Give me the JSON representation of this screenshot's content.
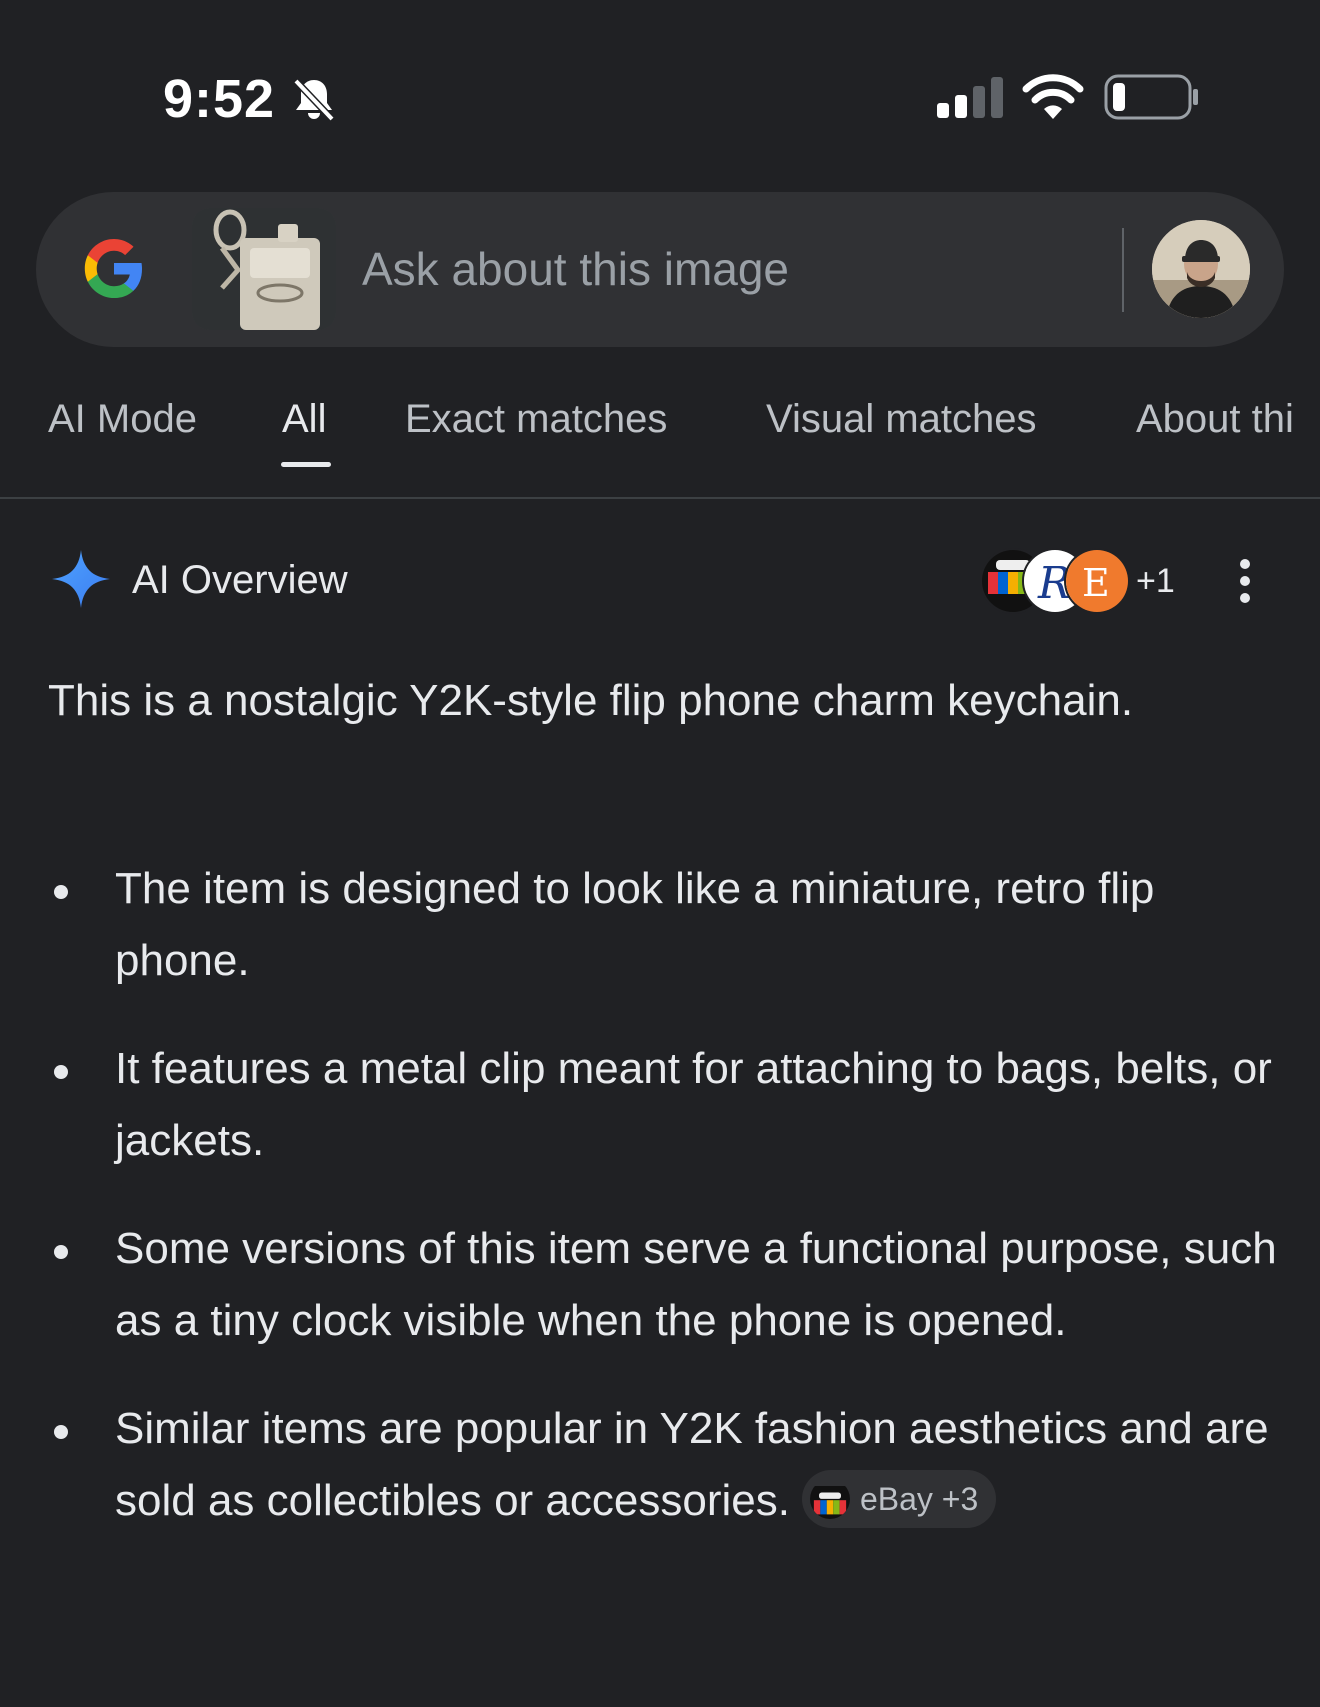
{
  "status_bar": {
    "time": "9:52"
  },
  "search": {
    "placeholder": "Ask about this image"
  },
  "tabs": [
    {
      "label": "AI Mode"
    },
    {
      "label": "All",
      "active": true
    },
    {
      "label": "Exact matches"
    },
    {
      "label": "Visual matches"
    },
    {
      "label": "About thi"
    }
  ],
  "ai_overview": {
    "title": "AI Overview",
    "sources_more": "+1",
    "summary": "This is a nostalgic Y2K-style flip phone charm keychain.",
    "bullets": [
      "The item is designed to look like a miniature, retro flip phone.",
      "It features a metal clip meant for attaching to bags, belts, or jackets.",
      "Some versions of this item serve a functional purpose, such as a tiny clock visible when the phone is opened.",
      "Similar items are popular in Y2K fashion aesthetics and are sold as collectibles or accessories."
    ],
    "citation_chip": {
      "label": "eBay +3"
    }
  },
  "colors": {
    "background": "#202124",
    "surface": "#303134",
    "text": "#e8eaed",
    "muted": "#9aa0a6"
  }
}
